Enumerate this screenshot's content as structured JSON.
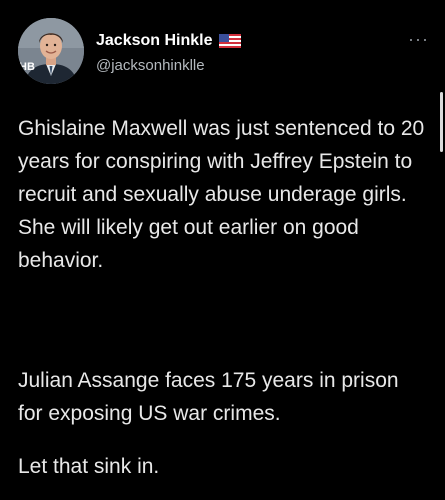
{
  "author": {
    "display_name": "Jackson Hinkle",
    "handle": "@jacksonhinklle",
    "avatar_badge": "HB",
    "flag_icon": "us-flag-icon"
  },
  "header": {
    "more_icon": "more-options-icon"
  },
  "tweet": {
    "paragraphs": [
      "Ghislaine Maxwell was just sentenced to 20 years for conspiring with Jeffrey Epstein to recruit and sexually abuse underage girls. She will likely get out earlier on good behavior.",
      "Julian Assange faces 175 years in prison for exposing US war crimes.",
      "Let that sink in."
    ]
  },
  "colors": {
    "background": "#000000",
    "text": "#e8e8e8",
    "handle": "#b4b9be"
  }
}
